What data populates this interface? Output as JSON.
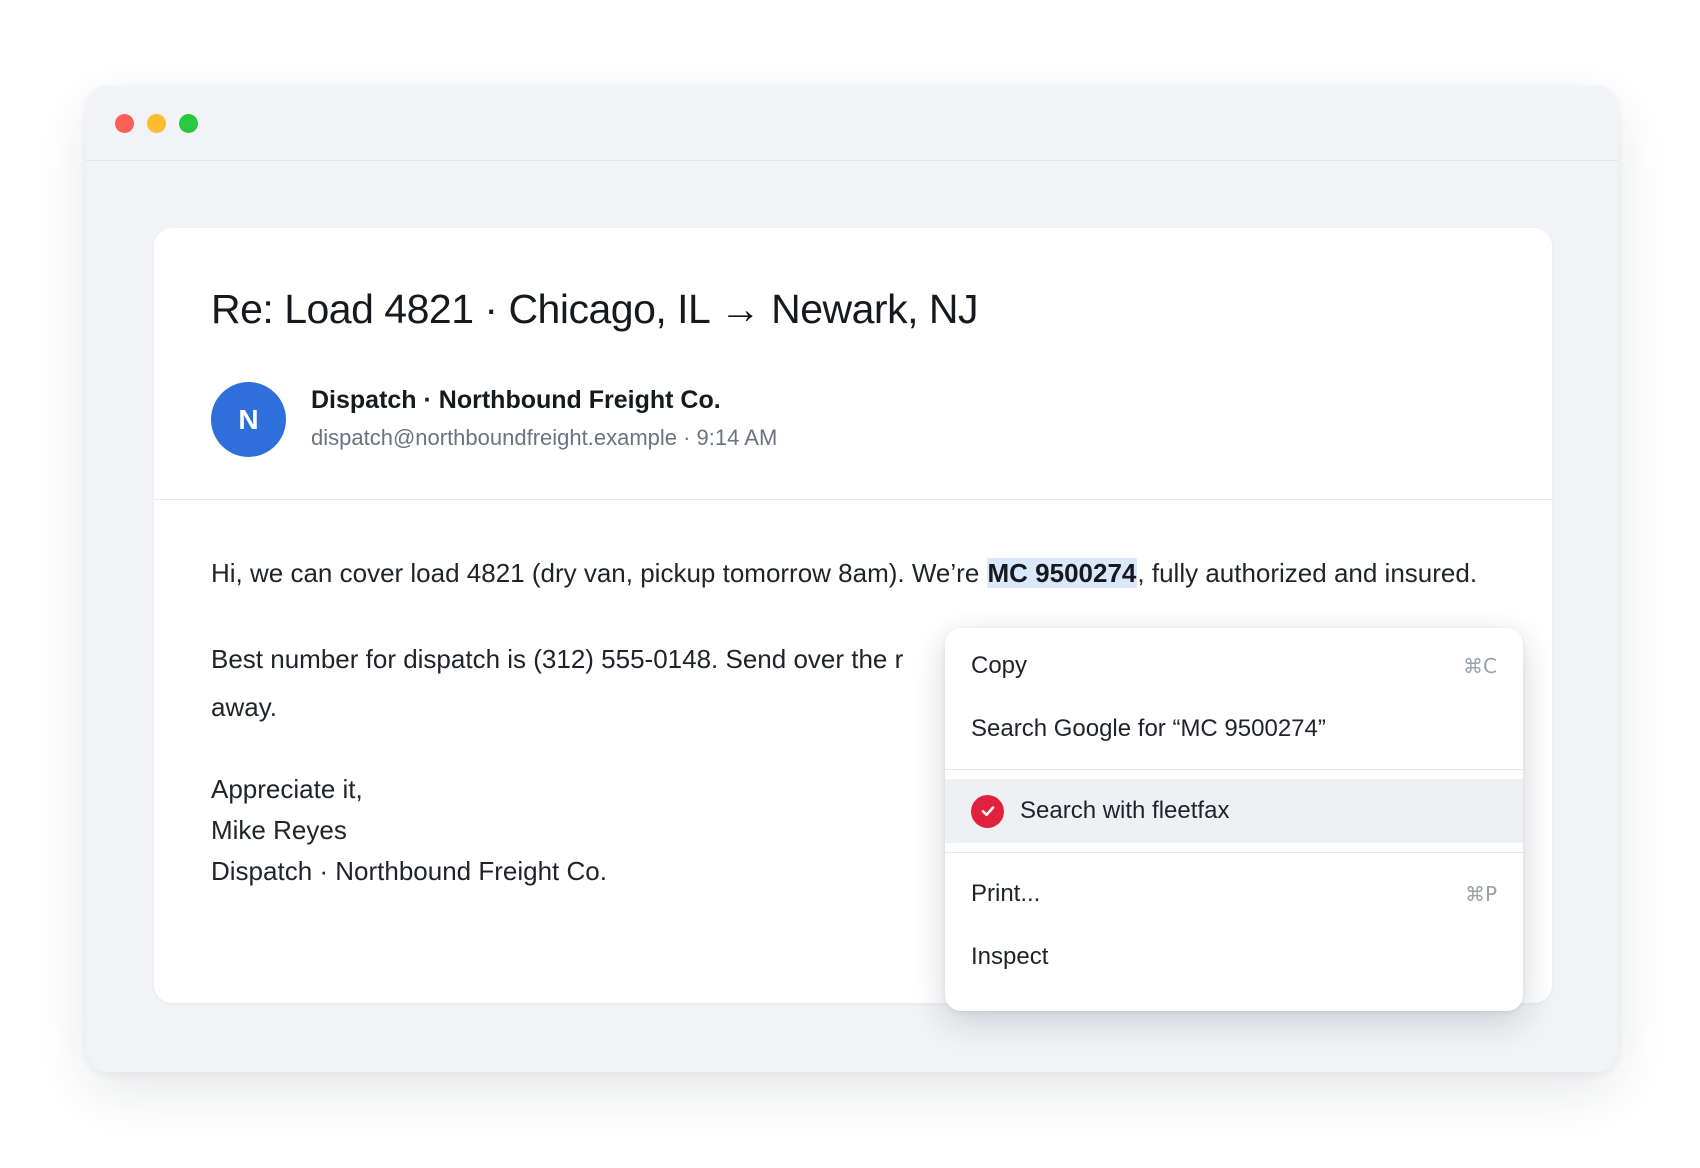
{
  "window": {
    "traffic_lights": [
      "close",
      "minimize",
      "zoom"
    ]
  },
  "email": {
    "subject": "Re: Load 4821 · Chicago, IL → Newark, NJ",
    "avatar_initial": "N",
    "sender_name": "Dispatch · Northbound Freight Co.",
    "sender_meta": "dispatch@northboundfreight.example · 9:14 AM",
    "body": {
      "p1_before": "Hi, we can cover load 4821 (dry van, pickup tomorrow 8am). We’re ",
      "p1_highlight": "MC 9500274",
      "p1_after": ", fully authorized and insured.",
      "p2": "Best number for dispatch is (312) 555-0148. Send over the r",
      "p2_end": "away.",
      "sign_1": "Appreciate it,",
      "sign_2": "Mike Reyes",
      "sign_3": "Dispatch · Northbound Freight Co."
    }
  },
  "context_menu": {
    "copy": "Copy",
    "copy_shortcut": "⌘C",
    "search_google": "Search Google for “MC 9500274”",
    "search_fleetfax": "Search with fleetfax",
    "print": "Print...",
    "print_shortcut": "⌘P",
    "inspect": "Inspect"
  },
  "colors": {
    "avatar": "#2f6fdc",
    "highlight": "#dbe7fb",
    "fleetfax_badge": "#e0223e"
  }
}
